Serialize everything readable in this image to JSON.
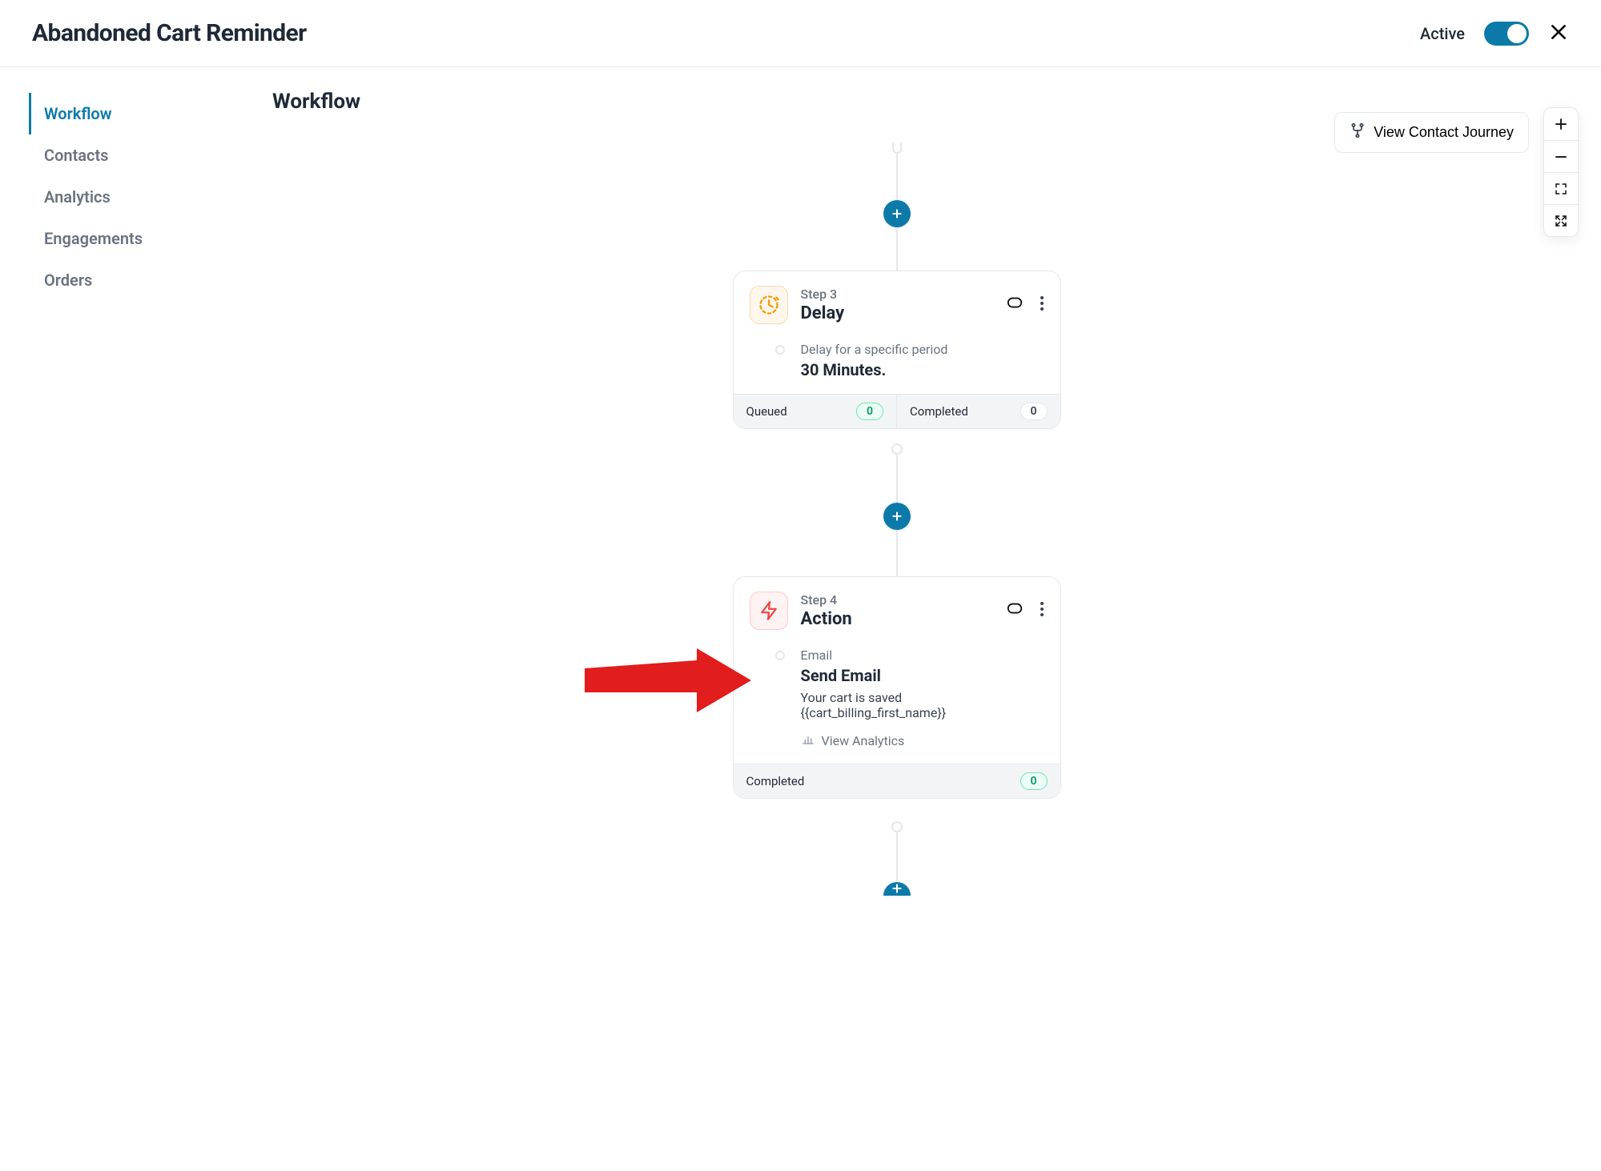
{
  "header": {
    "title": "Abandoned Cart Reminder",
    "status_label": "Active"
  },
  "sidebar": {
    "items": [
      {
        "label": "Workflow",
        "active": true
      },
      {
        "label": "Contacts",
        "active": false
      },
      {
        "label": "Analytics",
        "active": false
      },
      {
        "label": "Engagements",
        "active": false
      },
      {
        "label": "Orders",
        "active": false
      }
    ]
  },
  "canvas": {
    "title": "Workflow",
    "journey_button": "View Contact Journey",
    "nodes": [
      {
        "id": "step3",
        "icon": "clock-icon",
        "step_label": "Step 3",
        "title": "Delay",
        "body_label": "Delay for a specific period",
        "body_value": "30 Minutes.",
        "footer": [
          {
            "label": "Queued",
            "value": "0",
            "style": "green"
          },
          {
            "label": "Completed",
            "value": "0",
            "style": "plain"
          }
        ]
      },
      {
        "id": "step4",
        "icon": "bolt-icon",
        "step_label": "Step 4",
        "title": "Action",
        "body_label": "Email",
        "body_value": "Send Email",
        "body_sub": "Your cart is saved {{cart_billing_first_name}}",
        "analytics_label": "View Analytics",
        "footer": [
          {
            "label": "Completed",
            "value": "0",
            "style": "green"
          }
        ]
      }
    ]
  }
}
